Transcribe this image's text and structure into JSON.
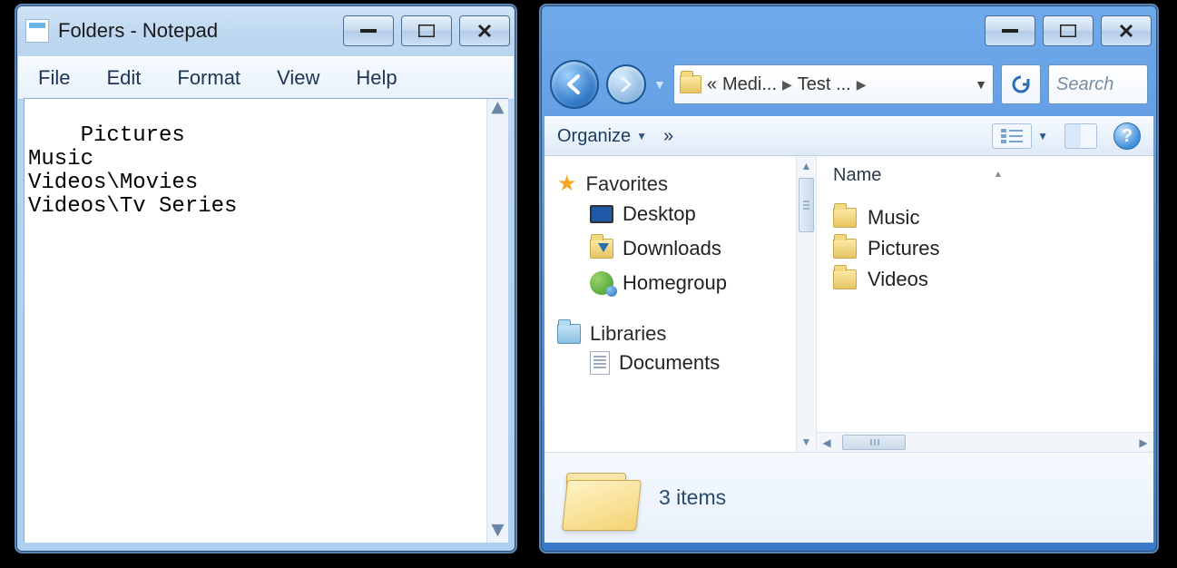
{
  "notepad": {
    "title": "Folders - Notepad",
    "menu": [
      "File",
      "Edit",
      "Format",
      "View",
      "Help"
    ],
    "text": "Pictures\nMusic\nVideos\\Movies\nVideos\\Tv Series"
  },
  "explorer": {
    "address": {
      "chevrons": "«",
      "seg1": "Medi...",
      "seg2": "Test ..."
    },
    "search_placeholder": "Search ",
    "toolbar": {
      "organize": "Organize",
      "more": "»"
    },
    "nav": {
      "favorites": "Favorites",
      "desktop": "Desktop",
      "downloads": "Downloads",
      "homegroup": "Homegroup",
      "libraries": "Libraries",
      "documents": "Documents"
    },
    "list": {
      "header": "Name",
      "items": [
        "Music",
        "Pictures",
        "Videos"
      ]
    },
    "details": "3 items"
  }
}
